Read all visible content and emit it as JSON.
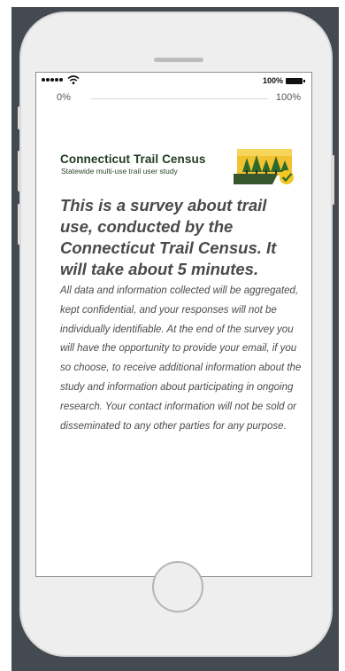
{
  "statusbar": {
    "battery_percent": "100%"
  },
  "progress": {
    "start_label": "0%",
    "end_label": "100%",
    "value": 0
  },
  "logo": {
    "title": "Connecticut Trail Census",
    "subtitle": "Statewide multi-use trail user study"
  },
  "survey": {
    "heading": "This is a survey about trail use, conducted by the Connecticut Trail Census. It will take about 5 minutes.",
    "body": "All data and information collected will be aggregated, kept confidential, and your responses will not be individually identifiable. At the end of the survey you will have the opportunity to provide your email, if you so choose, to receive additional information about the study and information about participating in ongoing research.  Your contact information will not be sold or disseminated to any other parties for any purpose."
  },
  "colors": {
    "backdrop": "#444a51",
    "logo_green": "#1f3b1f",
    "logo_yellow": "#f2c230",
    "check_yellow": "#f3c623"
  },
  "icons": [
    "signal-dots-icon",
    "wifi-icon",
    "battery-icon",
    "trail-census-logo-icon",
    "home-button-icon"
  ]
}
